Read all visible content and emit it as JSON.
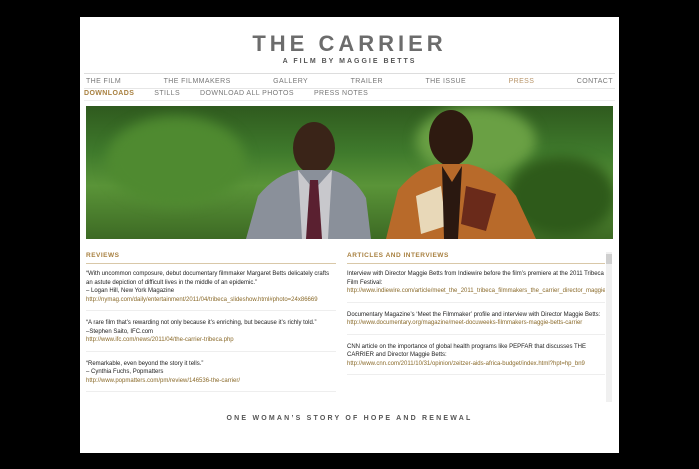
{
  "header": {
    "title": "THE CARRIER",
    "subtitle": "A FILM BY MAGGIE BETTS"
  },
  "nav": [
    "THE FILM",
    "THE FILMMAKERS",
    "GALLERY",
    "TRAILER",
    "THE ISSUE",
    "PRESS",
    "CONTACT"
  ],
  "subnav": [
    "DOWNLOADS",
    "STILLS",
    "DOWNLOAD ALL PHOTOS",
    "PRESS NOTES"
  ],
  "reviews": {
    "heading": "REVIEWS",
    "items": [
      {
        "quote": "“With uncommon composure, debut documentary filmmaker Margaret Betts delicately crafts an astute depiction of difficult lives in the middle of an epidemic.”",
        "attribution": "– Logan Hill, New York Magazine",
        "link": "http://nymag.com/daily/entertainment/2011/04/tribeca_slideshow.html#photo=24x86669"
      },
      {
        "quote": "“A rare film that’s rewarding not only because it’s enriching, but because it’s richly told.”",
        "attribution": "–Stephen Saito, IFC.com",
        "link": "http://www.ifc.com/news/2011/04/the-carrier-tribeca.php"
      },
      {
        "quote": "“Remarkable, even beyond the story it tells.”",
        "attribution": "– Cynthia Fuchs, Popmatters",
        "link": "http://www.popmatters.com/pm/review/146536-the-carrier/"
      }
    ]
  },
  "articles": {
    "heading": "ARTICLES AND INTERVIEWS",
    "items": [
      {
        "text": "Interview with Director Maggie Betts from Indiewire before the film’s premiere at the 2011 Tribeca Film Festival:",
        "link": "http://www.indiewire.com/article/meet_the_2011_tribeca_filmmakers_the_carrier_director_maggie"
      },
      {
        "text": "Documentary Magazine’s ‘Meet the Filmmaker’ profile and interview with Director Maggie Betts:",
        "link": "http://www.documentary.org/magazine/meet-docuweeks-filmmakers-maggie-betts-carrier"
      },
      {
        "text": "CNN article on the importance of global health programs like PEPFAR that discusses THE CARRIER and Director Maggie Betts:",
        "link": "http://www.cnn.com/2011/10/31/opinion/zeitzer-aids-africa-budget/index.html?hpt=hp_bn9"
      }
    ]
  },
  "tagline": "ONE WOMAN’S STORY OF HOPE AND RENEWAL",
  "colors": {
    "accent": "#a88040",
    "background": "#000000",
    "panel": "#ffffff"
  }
}
